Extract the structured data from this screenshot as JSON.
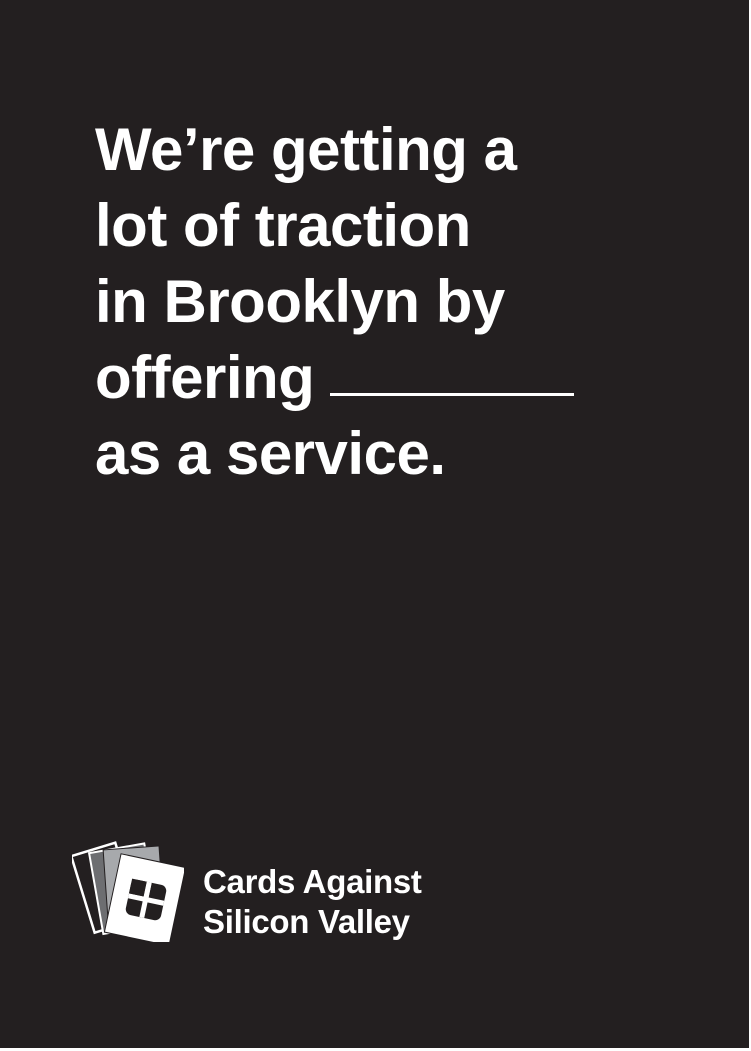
{
  "card": {
    "background_color": "#231f20",
    "text_color": "#ffffff",
    "prompt_lines": [
      "We’re getting a",
      "lot of traction",
      "in Brooklyn by",
      "offering",
      "as a service."
    ],
    "blank_after_line": 4
  },
  "brand": {
    "logo_icon": "stacked-cards-logo-icon",
    "name_line_1": "Cards Against",
    "name_line_2": "Silicon Valley"
  }
}
